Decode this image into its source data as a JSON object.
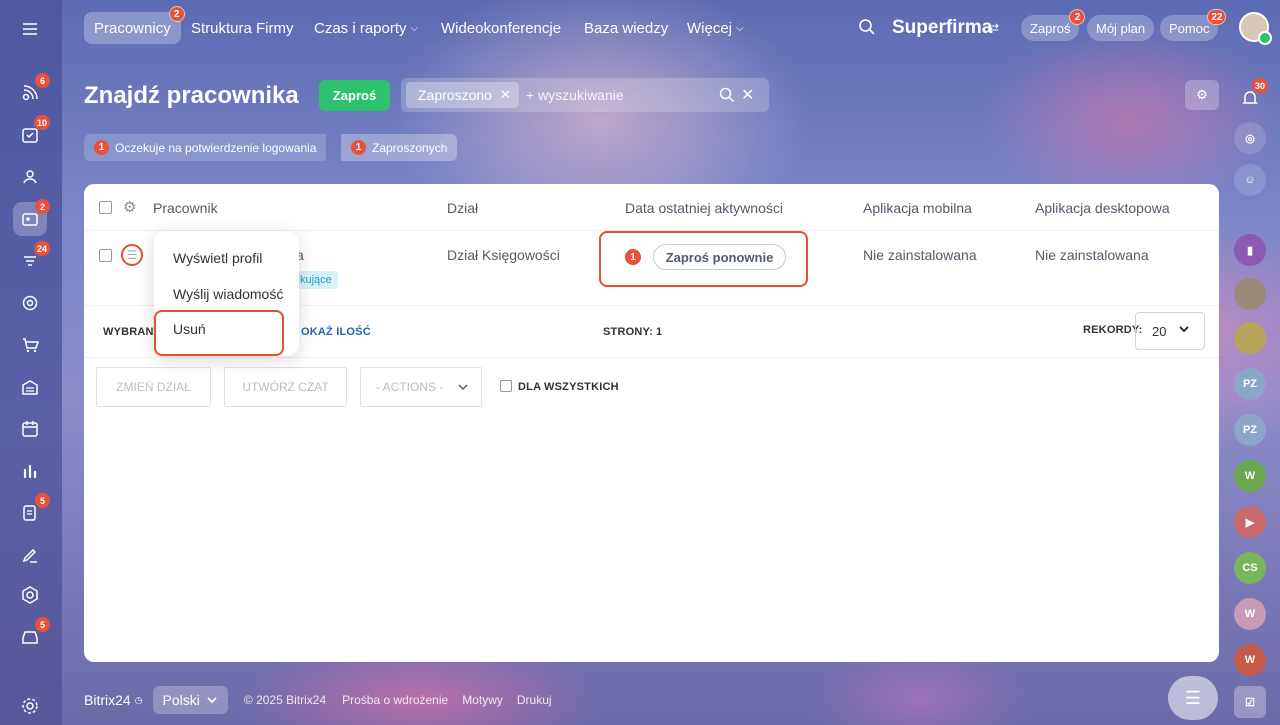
{
  "topnav": {
    "items": [
      "Pracownicy",
      "Struktura Firmy",
      "Czas i raporty",
      "Wideokonferencje",
      "Baza wiedzy",
      "Więcej"
    ],
    "active_badge": "2",
    "company": "Superfirma",
    "invite": "Zaproś",
    "invite_badge": "2",
    "myplan": "Mój plan",
    "help": "Pomoc",
    "help_badge": "22"
  },
  "left_rail": {
    "badges": [
      "6",
      "10",
      "2",
      "24",
      "5",
      "5"
    ]
  },
  "right_rail": {
    "bell_badge": "30",
    "avatars": [
      "PZ",
      "PZ",
      "W",
      "CS",
      "W",
      "W"
    ]
  },
  "page": {
    "title": "Znajdź pracownika",
    "invite_button": "Zaproś",
    "search_tag": "Zaproszono",
    "search_placeholder": "+ wyszukiwanie"
  },
  "chips": [
    {
      "count": "1",
      "label": "Oczekuje na potwierdzenie logowania"
    },
    {
      "count": "1",
      "label": "Zaproszonych"
    }
  ],
  "table": {
    "headers": [
      "Pracownik",
      "Dział",
      "Data ostatniej aktywności",
      "Aplikacja mobilna",
      "Aplikacja desktopowa"
    ],
    "row": {
      "name_tail": "va",
      "status_tail": "kujące",
      "department": "Dział Księgowości",
      "activity_badge": "1",
      "reinvite": "Zaproś ponownie",
      "mobile": "Nie zainstalowana",
      "desktop": "Nie zainstalowana"
    },
    "footer": {
      "selected": "WYBRANO",
      "show_count": "OKAŻ ILOŚĆ",
      "pages_label": "STRONY:",
      "pages_value": "1",
      "records_label": "REKORDY:",
      "records_value": "20"
    }
  },
  "actions": {
    "change_dept": "ZMIEŃ DZIAŁ",
    "create_chat": "UTWÓRZ CZAT",
    "actions_select": "- ACTIONS -",
    "for_all": "DLA WSZYSTKICH"
  },
  "context_menu": [
    "Wyświetl profil",
    "Wyślij wiadomość",
    "Usuń"
  ],
  "footer": {
    "brand": "Bitrix24",
    "lang": "Polski",
    "copyright": "© 2025 Bitrix24",
    "link1": "Prośba o wdrożenie",
    "link2": "Motywy",
    "link3": "Drukuj"
  },
  "colors": {
    "accent_green": "#2fc26e",
    "badge_red": "#e8513c",
    "highlight": "#e0532f"
  }
}
